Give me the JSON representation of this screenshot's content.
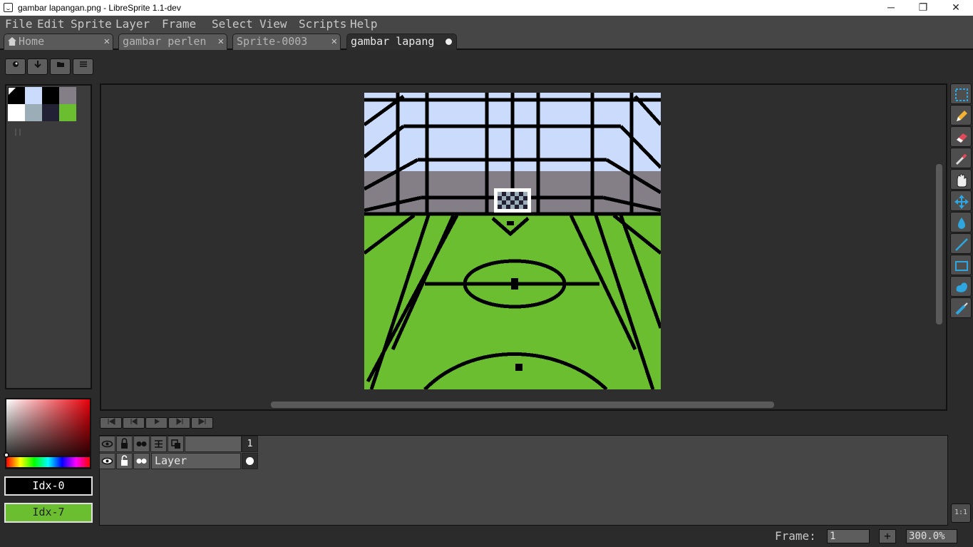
{
  "window": {
    "title": "gambar lapangan.png - LibreSprite 1.1-dev",
    "minimize": "─",
    "maximize": "❐",
    "close": "✕"
  },
  "menu": [
    {
      "label": "File"
    },
    {
      "label": "Edit"
    },
    {
      "label": "Sprite"
    },
    {
      "label": "Layer"
    },
    {
      "label": "Frame"
    },
    {
      "label": "Select"
    },
    {
      "label": "View"
    },
    {
      "label": "Scripts"
    },
    {
      "label": "Help"
    }
  ],
  "tabs": [
    {
      "label": "Home",
      "close": "✕"
    },
    {
      "label": "gambar perlen",
      "close": "✕"
    },
    {
      "label": "Sprite-0003",
      "close": "✕"
    },
    {
      "label": "gambar lapang",
      "modified": true
    }
  ],
  "palette": {
    "swatches": [
      "#000000",
      "#cbdbfc",
      "#000000",
      "#847e87",
      "#ffffff",
      "#9badb7",
      "#222034",
      "#6abe30"
    ]
  },
  "colors": {
    "foreground_label": "Idx-0",
    "background_label": "Idx-7",
    "foreground": "#000000",
    "background": "#6abe30"
  },
  "tools": [
    {
      "icon": "rectangle-marquee-icon"
    },
    {
      "icon": "pencil-icon"
    },
    {
      "icon": "eraser-icon"
    },
    {
      "icon": "eyedropper-icon"
    },
    {
      "icon": "hand-icon"
    },
    {
      "icon": "move-icon"
    },
    {
      "icon": "paint-bucket-icon"
    },
    {
      "icon": "line-icon"
    },
    {
      "icon": "rectangle-icon"
    },
    {
      "icon": "contour-icon"
    },
    {
      "icon": "blur-icon"
    }
  ],
  "timeline": {
    "layer_name": "Layer",
    "frame_header": "1"
  },
  "status": {
    "frame_label": "Frame:",
    "frame_value": "1",
    "add_frame": "+",
    "zoom": "300.0%",
    "one_to_one": "1:1"
  }
}
